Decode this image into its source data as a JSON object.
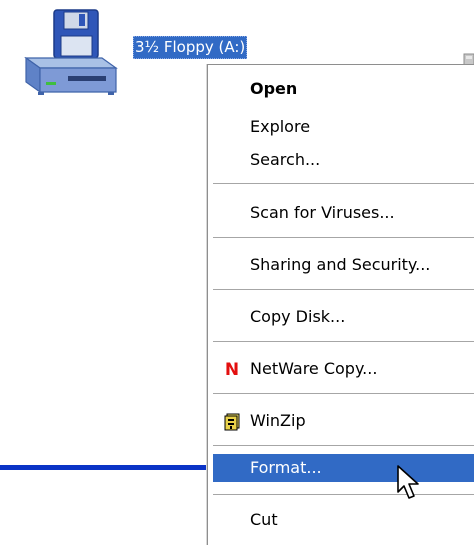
{
  "desktop": {
    "drive": {
      "label": "3½ Floppy (A:)",
      "icon": "floppy-drive-icon"
    }
  },
  "context_menu": {
    "items": [
      {
        "label": "Open",
        "bold": true
      },
      {
        "label": "Explore"
      },
      {
        "label": "Search..."
      },
      {
        "label": "Scan for Viruses..."
      },
      {
        "label": "Sharing and Security..."
      },
      {
        "label": "Copy Disk..."
      },
      {
        "label": "NetWare Copy...",
        "icon": "netware-n-icon"
      },
      {
        "label": "WinZip",
        "icon": "winzip-icon"
      },
      {
        "label": "Format...",
        "highlighted": true
      },
      {
        "label": "Cut"
      }
    ]
  },
  "colors": {
    "selection": "#316ac5",
    "netware_red": "#e30f0f",
    "taskbar_line": "#0a33c6"
  }
}
